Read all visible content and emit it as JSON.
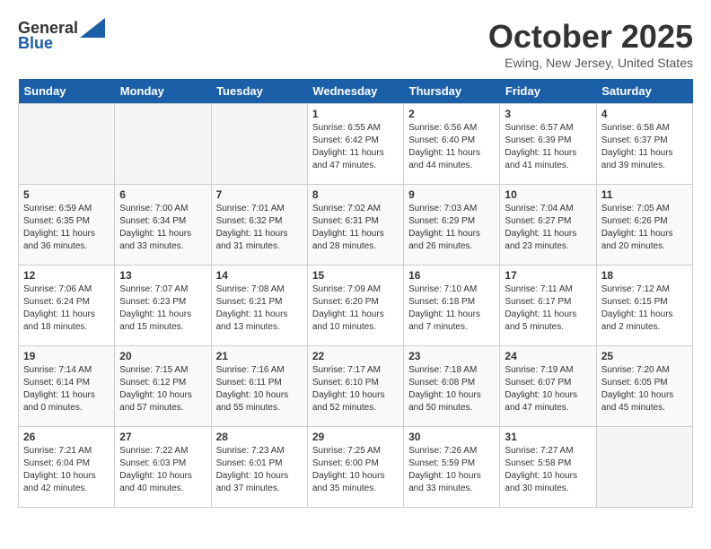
{
  "header": {
    "logo_general": "General",
    "logo_blue": "Blue",
    "month": "October 2025",
    "location": "Ewing, New Jersey, United States"
  },
  "calendar": {
    "days_of_week": [
      "Sunday",
      "Monday",
      "Tuesday",
      "Wednesday",
      "Thursday",
      "Friday",
      "Saturday"
    ],
    "weeks": [
      [
        {
          "day": "",
          "info": ""
        },
        {
          "day": "",
          "info": ""
        },
        {
          "day": "",
          "info": ""
        },
        {
          "day": "1",
          "info": "Sunrise: 6:55 AM\nSunset: 6:42 PM\nDaylight: 11 hours and 47 minutes."
        },
        {
          "day": "2",
          "info": "Sunrise: 6:56 AM\nSunset: 6:40 PM\nDaylight: 11 hours and 44 minutes."
        },
        {
          "day": "3",
          "info": "Sunrise: 6:57 AM\nSunset: 6:39 PM\nDaylight: 11 hours and 41 minutes."
        },
        {
          "day": "4",
          "info": "Sunrise: 6:58 AM\nSunset: 6:37 PM\nDaylight: 11 hours and 39 minutes."
        }
      ],
      [
        {
          "day": "5",
          "info": "Sunrise: 6:59 AM\nSunset: 6:35 PM\nDaylight: 11 hours and 36 minutes."
        },
        {
          "day": "6",
          "info": "Sunrise: 7:00 AM\nSunset: 6:34 PM\nDaylight: 11 hours and 33 minutes."
        },
        {
          "day": "7",
          "info": "Sunrise: 7:01 AM\nSunset: 6:32 PM\nDaylight: 11 hours and 31 minutes."
        },
        {
          "day": "8",
          "info": "Sunrise: 7:02 AM\nSunset: 6:31 PM\nDaylight: 11 hours and 28 minutes."
        },
        {
          "day": "9",
          "info": "Sunrise: 7:03 AM\nSunset: 6:29 PM\nDaylight: 11 hours and 26 minutes."
        },
        {
          "day": "10",
          "info": "Sunrise: 7:04 AM\nSunset: 6:27 PM\nDaylight: 11 hours and 23 minutes."
        },
        {
          "day": "11",
          "info": "Sunrise: 7:05 AM\nSunset: 6:26 PM\nDaylight: 11 hours and 20 minutes."
        }
      ],
      [
        {
          "day": "12",
          "info": "Sunrise: 7:06 AM\nSunset: 6:24 PM\nDaylight: 11 hours and 18 minutes."
        },
        {
          "day": "13",
          "info": "Sunrise: 7:07 AM\nSunset: 6:23 PM\nDaylight: 11 hours and 15 minutes."
        },
        {
          "day": "14",
          "info": "Sunrise: 7:08 AM\nSunset: 6:21 PM\nDaylight: 11 hours and 13 minutes."
        },
        {
          "day": "15",
          "info": "Sunrise: 7:09 AM\nSunset: 6:20 PM\nDaylight: 11 hours and 10 minutes."
        },
        {
          "day": "16",
          "info": "Sunrise: 7:10 AM\nSunset: 6:18 PM\nDaylight: 11 hours and 7 minutes."
        },
        {
          "day": "17",
          "info": "Sunrise: 7:11 AM\nSunset: 6:17 PM\nDaylight: 11 hours and 5 minutes."
        },
        {
          "day": "18",
          "info": "Sunrise: 7:12 AM\nSunset: 6:15 PM\nDaylight: 11 hours and 2 minutes."
        }
      ],
      [
        {
          "day": "19",
          "info": "Sunrise: 7:14 AM\nSunset: 6:14 PM\nDaylight: 11 hours and 0 minutes."
        },
        {
          "day": "20",
          "info": "Sunrise: 7:15 AM\nSunset: 6:12 PM\nDaylight: 10 hours and 57 minutes."
        },
        {
          "day": "21",
          "info": "Sunrise: 7:16 AM\nSunset: 6:11 PM\nDaylight: 10 hours and 55 minutes."
        },
        {
          "day": "22",
          "info": "Sunrise: 7:17 AM\nSunset: 6:10 PM\nDaylight: 10 hours and 52 minutes."
        },
        {
          "day": "23",
          "info": "Sunrise: 7:18 AM\nSunset: 6:08 PM\nDaylight: 10 hours and 50 minutes."
        },
        {
          "day": "24",
          "info": "Sunrise: 7:19 AM\nSunset: 6:07 PM\nDaylight: 10 hours and 47 minutes."
        },
        {
          "day": "25",
          "info": "Sunrise: 7:20 AM\nSunset: 6:05 PM\nDaylight: 10 hours and 45 minutes."
        }
      ],
      [
        {
          "day": "26",
          "info": "Sunrise: 7:21 AM\nSunset: 6:04 PM\nDaylight: 10 hours and 42 minutes."
        },
        {
          "day": "27",
          "info": "Sunrise: 7:22 AM\nSunset: 6:03 PM\nDaylight: 10 hours and 40 minutes."
        },
        {
          "day": "28",
          "info": "Sunrise: 7:23 AM\nSunset: 6:01 PM\nDaylight: 10 hours and 37 minutes."
        },
        {
          "day": "29",
          "info": "Sunrise: 7:25 AM\nSunset: 6:00 PM\nDaylight: 10 hours and 35 minutes."
        },
        {
          "day": "30",
          "info": "Sunrise: 7:26 AM\nSunset: 5:59 PM\nDaylight: 10 hours and 33 minutes."
        },
        {
          "day": "31",
          "info": "Sunrise: 7:27 AM\nSunset: 5:58 PM\nDaylight: 10 hours and 30 minutes."
        },
        {
          "day": "",
          "info": ""
        }
      ]
    ]
  }
}
